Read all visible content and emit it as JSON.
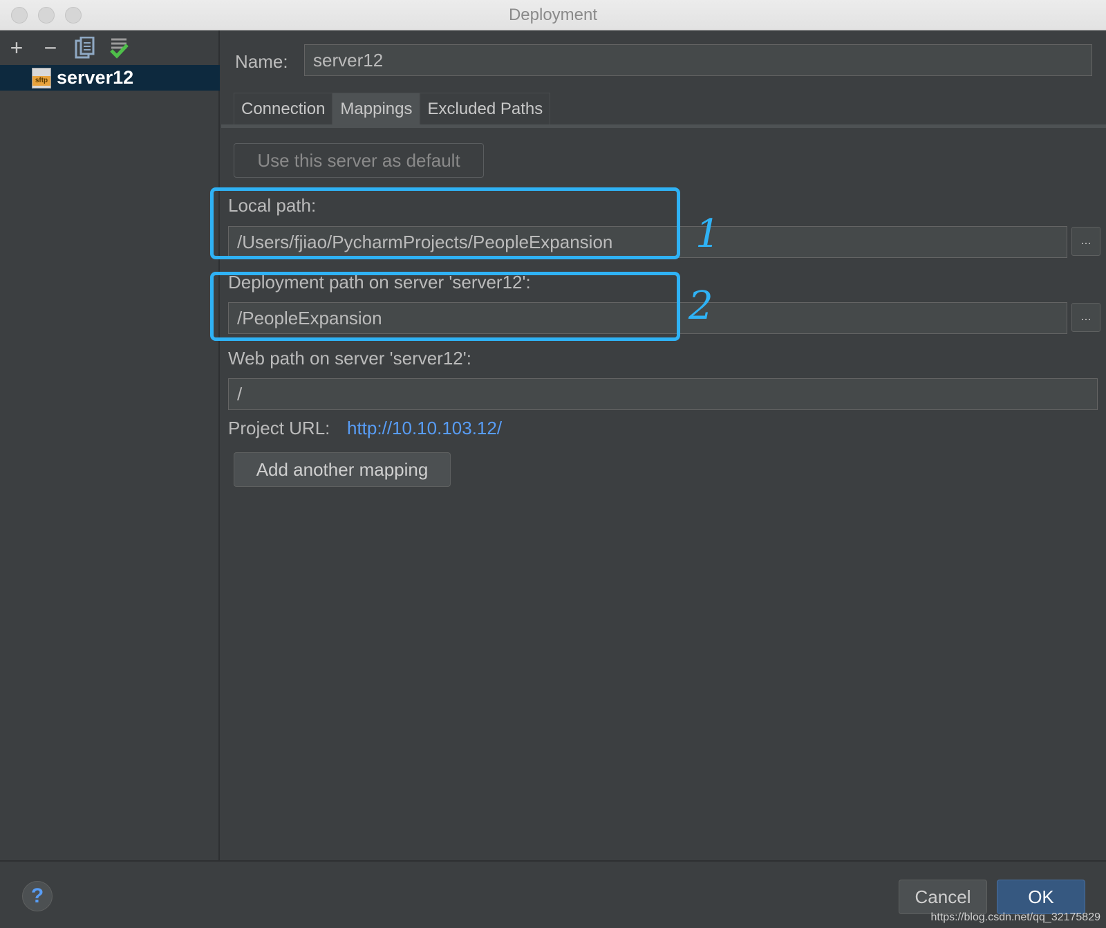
{
  "window": {
    "title": "Deployment"
  },
  "sidebar": {
    "toolbar": [
      {
        "icon": "plus-icon",
        "glyph": "+"
      },
      {
        "icon": "minus-icon",
        "glyph": "−"
      },
      {
        "icon": "copy-icon",
        "glyph": ""
      },
      {
        "icon": "check-default-icon",
        "glyph": ""
      }
    ],
    "servers": [
      {
        "label": "server12",
        "icon": "sftp-server-icon",
        "type_tag": "sftp"
      }
    ]
  },
  "form": {
    "name_label": "Name:",
    "name_value": "server12",
    "tabs": [
      {
        "label": "Connection",
        "active": false
      },
      {
        "label": "Mappings",
        "active": true
      },
      {
        "label": "Excluded Paths",
        "active": false
      }
    ],
    "default_button": "Use this server as default",
    "local_path_label": "Local path:",
    "local_path_value": "/Users/fjiao/PycharmProjects/PeopleExpansion",
    "deploy_path_label": "Deployment path on server 'server12':",
    "deploy_path_value": "/PeopleExpansion",
    "web_path_label": "Web path on server 'server12':",
    "web_path_value": "/",
    "project_url_label": "Project URL:",
    "project_url_value": "http://10.10.103.12/",
    "browse_label": "...",
    "add_mapping_button": "Add another mapping"
  },
  "annotations": {
    "mark_1": "1",
    "mark_2": "2",
    "color": "#2fb2f5"
  },
  "footer": {
    "help_label": "?",
    "cancel_label": "Cancel",
    "ok_label": "OK",
    "watermark": "https://blog.csdn.net/qq_32175829"
  },
  "colors": {
    "background": "#3c3f41",
    "selection": "#0d293e",
    "link": "#589df6",
    "ok_button": "#365880"
  }
}
